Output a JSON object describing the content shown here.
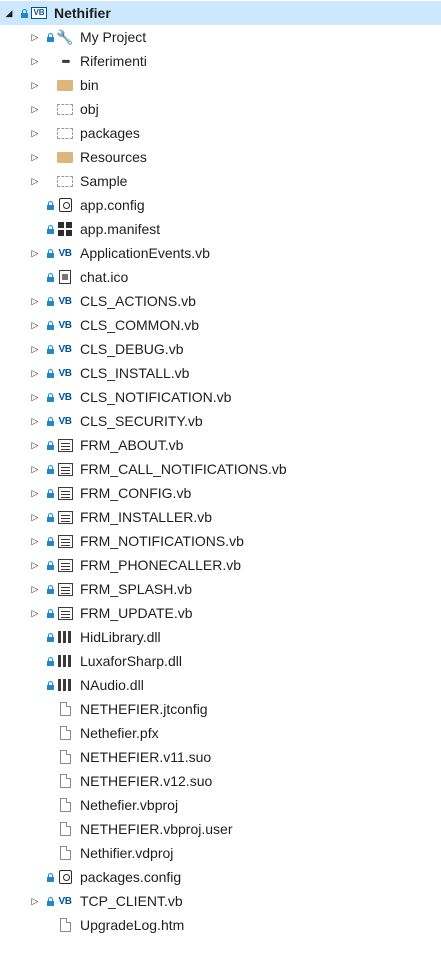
{
  "icon_names": {
    "vb": "visual-basic-file-icon",
    "vbproj": "vb-project-icon",
    "folder": "folder-icon",
    "folder-dash": "excluded-folder-icon",
    "file": "file-icon",
    "form": "form-icon",
    "dll": "dll-assembly-icon",
    "ref": "references-icon",
    "wrench": "wrench-icon",
    "config": "config-file-icon",
    "manifest": "manifest-icon",
    "ico": "ico-file-icon",
    "lock": "source-control-lock-icon"
  },
  "colors": {
    "selection": "#cce8ff",
    "lock": "#1e88c8",
    "vb": "#00539c",
    "folder": "#dcb67a"
  },
  "tree": {
    "items": [
      {
        "label": "Nethifier",
        "level": 0,
        "expander": "expanded",
        "lock": true,
        "icon": "vbproj",
        "selected": true,
        "bold": true
      },
      {
        "label": "My Project",
        "level": 1,
        "expander": "collapsed",
        "lock": true,
        "icon": "wrench"
      },
      {
        "label": "Riferimenti",
        "level": 1,
        "expander": "collapsed",
        "lock": false,
        "icon": "ref"
      },
      {
        "label": "bin",
        "level": 1,
        "expander": "collapsed",
        "lock": false,
        "icon": "folder"
      },
      {
        "label": "obj",
        "level": 1,
        "expander": "collapsed",
        "lock": false,
        "icon": "folder-dash"
      },
      {
        "label": "packages",
        "level": 1,
        "expander": "collapsed",
        "lock": false,
        "icon": "folder-dash"
      },
      {
        "label": "Resources",
        "level": 1,
        "expander": "collapsed",
        "lock": false,
        "icon": "folder"
      },
      {
        "label": "Sample",
        "level": 1,
        "expander": "collapsed",
        "lock": false,
        "icon": "folder-dash"
      },
      {
        "label": "app.config",
        "level": 1,
        "expander": "none",
        "lock": true,
        "icon": "config"
      },
      {
        "label": "app.manifest",
        "level": 1,
        "expander": "none",
        "lock": true,
        "icon": "manifest"
      },
      {
        "label": "ApplicationEvents.vb",
        "level": 1,
        "expander": "collapsed",
        "lock": true,
        "icon": "vb"
      },
      {
        "label": "chat.ico",
        "level": 1,
        "expander": "none",
        "lock": true,
        "icon": "ico"
      },
      {
        "label": "CLS_ACTIONS.vb",
        "level": 1,
        "expander": "collapsed",
        "lock": true,
        "icon": "vb"
      },
      {
        "label": "CLS_COMMON.vb",
        "level": 1,
        "expander": "collapsed",
        "lock": true,
        "icon": "vb"
      },
      {
        "label": "CLS_DEBUG.vb",
        "level": 1,
        "expander": "collapsed",
        "lock": true,
        "icon": "vb"
      },
      {
        "label": "CLS_INSTALL.vb",
        "level": 1,
        "expander": "collapsed",
        "lock": true,
        "icon": "vb"
      },
      {
        "label": "CLS_NOTIFICATION.vb",
        "level": 1,
        "expander": "collapsed",
        "lock": true,
        "icon": "vb"
      },
      {
        "label": "CLS_SECURITY.vb",
        "level": 1,
        "expander": "collapsed",
        "lock": true,
        "icon": "vb"
      },
      {
        "label": "FRM_ABOUT.vb",
        "level": 1,
        "expander": "collapsed",
        "lock": true,
        "icon": "form"
      },
      {
        "label": "FRM_CALL_NOTIFICATIONS.vb",
        "level": 1,
        "expander": "collapsed",
        "lock": true,
        "icon": "form"
      },
      {
        "label": "FRM_CONFIG.vb",
        "level": 1,
        "expander": "collapsed",
        "lock": true,
        "icon": "form"
      },
      {
        "label": "FRM_INSTALLER.vb",
        "level": 1,
        "expander": "collapsed",
        "lock": true,
        "icon": "form"
      },
      {
        "label": "FRM_NOTIFICATIONS.vb",
        "level": 1,
        "expander": "collapsed",
        "lock": true,
        "icon": "form"
      },
      {
        "label": "FRM_PHONECALLER.vb",
        "level": 1,
        "expander": "collapsed",
        "lock": true,
        "icon": "form"
      },
      {
        "label": "FRM_SPLASH.vb",
        "level": 1,
        "expander": "collapsed",
        "lock": true,
        "icon": "form"
      },
      {
        "label": "FRM_UPDATE.vb",
        "level": 1,
        "expander": "collapsed",
        "lock": true,
        "icon": "form"
      },
      {
        "label": "HidLibrary.dll",
        "level": 1,
        "expander": "none",
        "lock": true,
        "icon": "dll"
      },
      {
        "label": "LuxaforSharp.dll",
        "level": 1,
        "expander": "none",
        "lock": true,
        "icon": "dll"
      },
      {
        "label": "NAudio.dll",
        "level": 1,
        "expander": "none",
        "lock": true,
        "icon": "dll"
      },
      {
        "label": "NETHEFIER.jtconfig",
        "level": 1,
        "expander": "none",
        "lock": false,
        "icon": "file"
      },
      {
        "label": "Nethefier.pfx",
        "level": 1,
        "expander": "none",
        "lock": false,
        "icon": "file"
      },
      {
        "label": "NETHEFIER.v11.suo",
        "level": 1,
        "expander": "none",
        "lock": false,
        "icon": "file"
      },
      {
        "label": "NETHEFIER.v12.suo",
        "level": 1,
        "expander": "none",
        "lock": false,
        "icon": "file"
      },
      {
        "label": "Nethefier.vbproj",
        "level": 1,
        "expander": "none",
        "lock": false,
        "icon": "file"
      },
      {
        "label": "NETHEFIER.vbproj.user",
        "level": 1,
        "expander": "none",
        "lock": false,
        "icon": "file"
      },
      {
        "label": "Nethifier.vdproj",
        "level": 1,
        "expander": "none",
        "lock": false,
        "icon": "file"
      },
      {
        "label": "packages.config",
        "level": 1,
        "expander": "none",
        "lock": true,
        "icon": "config"
      },
      {
        "label": "TCP_CLIENT.vb",
        "level": 1,
        "expander": "collapsed",
        "lock": true,
        "icon": "vb"
      },
      {
        "label": "UpgradeLog.htm",
        "level": 1,
        "expander": "none",
        "lock": false,
        "icon": "file"
      }
    ]
  }
}
